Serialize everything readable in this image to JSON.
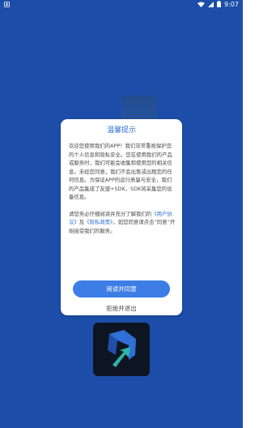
{
  "status_bar": {
    "time": "9:07",
    "left_icon": "notification-a-icon",
    "right_icons": [
      "wifi-icon",
      "signal-icon",
      "battery-icon"
    ]
  },
  "dialog": {
    "title": "温馨提示",
    "para1": "欢迎您使用我们的APP！我们非常重视保护您的个人信息和隐私安全。您在使用我们的产品或服务时，我们可能会收集和使用您的相关信息。未经您同意，我们不会出售或出租您的任何信息。为保证APP的运行质量与安全，我们的产品集成了友盟+SDK，SDK将采集您的设备信息。",
    "para2_prefix": "请您务必仔细阅读并充分了解我们的",
    "user_agreement": "《用户协议》",
    "and": "及",
    "privacy_policy": "《隐私政策》",
    "para2_suffix": "，如您同意请点击“同意”开始接受我们的服务。",
    "agree_button": "阅读并同意",
    "decline_button": "拒绝并退出"
  },
  "colors": {
    "background": "#1c4ea9",
    "accent": "#2f6fd6",
    "button": "#3d7de6"
  }
}
